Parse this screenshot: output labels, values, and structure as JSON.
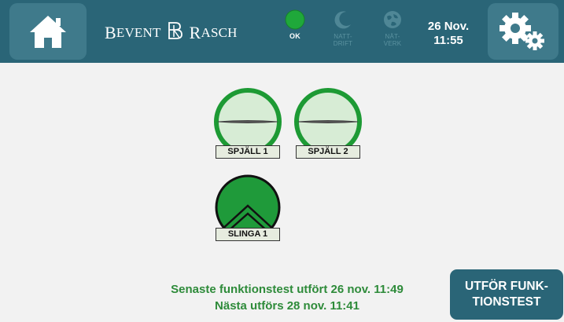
{
  "header": {
    "brand": {
      "left_initial": "B",
      "left_rest": "EVENT",
      "right_initial": "R",
      "right_rest": "ASCH",
      "icon": "logo-monogram"
    },
    "status": [
      {
        "id": "ok",
        "label": "OK",
        "icon": "green-status-dot",
        "color": "#1fa83a"
      },
      {
        "id": "night",
        "label_line1": "NATT-",
        "label_line2": "DRIFT",
        "icon": "moon-icon",
        "state": "inactive"
      },
      {
        "id": "network",
        "label_line1": "NÄT-",
        "label_line2": "VERK",
        "icon": "network-globe-icon",
        "state": "inactive"
      }
    ],
    "date": "26 Nov.",
    "time": "11:55",
    "home_icon": "home-icon",
    "settings_icon": "gear-icon"
  },
  "units": [
    {
      "label": "SPJÄLL 1",
      "type": "damper",
      "fill": "#d7ecd5",
      "ring": "#1d9a34"
    },
    {
      "label": "SPJÄLL 2",
      "type": "damper",
      "fill": "#d7ecd5",
      "ring": "#1d9a34"
    },
    {
      "label": "SLINGA 1",
      "type": "coil",
      "fill": "#1f9a3a",
      "ring": "#111111"
    }
  ],
  "test": {
    "last": "Senaste funktionstest utfört 26 nov. 11:49",
    "next": "Nästa utförs 28 nov. 11:41",
    "button_line1": "UTFÖR FUNK-",
    "button_line2": "TIONSTEST"
  },
  "colors": {
    "topbar": "#2a6577",
    "button": "#3f7a8b",
    "text_green": "#2e8b3a"
  }
}
